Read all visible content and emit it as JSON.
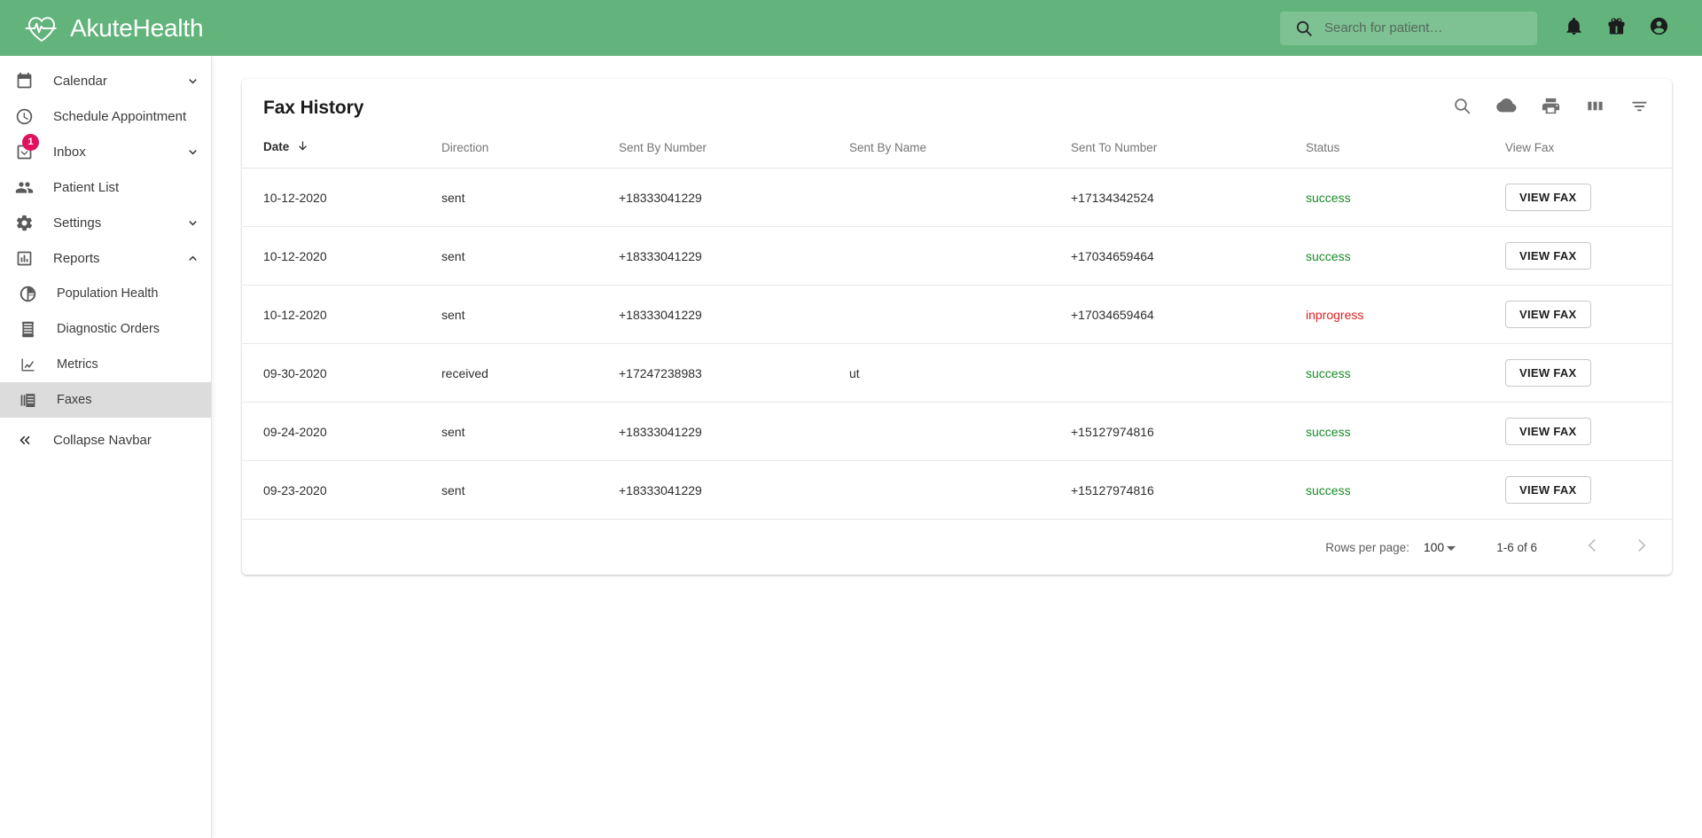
{
  "header": {
    "brand": "AkuteHealth",
    "brand_icon": "heartbeat-heart-icon",
    "search": {
      "placeholder": "Search for patient…",
      "value": "",
      "icon": "search-icon"
    },
    "actions": [
      {
        "name": "notifications-button",
        "icon": "bell-icon"
      },
      {
        "name": "rewards-button",
        "icon": "gift-icon"
      },
      {
        "name": "account-button",
        "icon": "account-circle-icon"
      }
    ],
    "background_color": "#62b47c"
  },
  "sidebar": {
    "items": [
      {
        "label": "Calendar",
        "icon": "calendar-icon",
        "chevron": "chevron-down",
        "expandable": true,
        "active": false,
        "sub": false
      },
      {
        "label": "Schedule Appointment",
        "icon": "clock-icon",
        "chevron": "",
        "expandable": false,
        "active": false,
        "sub": false
      },
      {
        "label": "Inbox",
        "icon": "inbox-icon",
        "chevron": "chevron-down",
        "expandable": true,
        "active": false,
        "sub": false,
        "badge": "1"
      },
      {
        "label": "Patient List",
        "icon": "people-icon",
        "chevron": "",
        "expandable": false,
        "active": false,
        "sub": false
      },
      {
        "label": "Settings",
        "icon": "gear-icon",
        "chevron": "chevron-down",
        "expandable": true,
        "active": false,
        "sub": false
      },
      {
        "label": "Reports",
        "icon": "bar-chart-icon",
        "chevron": "chevron-up",
        "expandable": true,
        "active": false,
        "sub": false
      },
      {
        "label": "Population Health",
        "icon": "pie-chart-icon",
        "chevron": "",
        "expandable": false,
        "active": false,
        "sub": true
      },
      {
        "label": "Diagnostic Orders",
        "icon": "receipt-icon",
        "chevron": "",
        "expandable": false,
        "active": false,
        "sub": true
      },
      {
        "label": "Metrics",
        "icon": "line-chart-icon",
        "chevron": "",
        "expandable": false,
        "active": false,
        "sub": true
      },
      {
        "label": "Faxes",
        "icon": "fax-document-icon",
        "chevron": "",
        "expandable": false,
        "active": true,
        "sub": true
      }
    ],
    "collapse": {
      "label": "Collapse Navbar",
      "icon": "chevron-double-left-icon"
    },
    "badge_color": "#e0115f",
    "active_color": "#dcdcdc"
  },
  "card": {
    "title": "Fax History",
    "toolbar": [
      {
        "name": "table-search-button",
        "icon": "search-icon"
      },
      {
        "name": "download-button",
        "icon": "cloud-download-icon"
      },
      {
        "name": "print-button",
        "icon": "print-icon"
      },
      {
        "name": "columns-button",
        "icon": "view-column-icon"
      },
      {
        "name": "filter-button",
        "icon": "filter-list-icon"
      }
    ],
    "table": {
      "columns": [
        {
          "label": "Date",
          "key": "date",
          "sorted": true,
          "sort_dir": "desc"
        },
        {
          "label": "Direction",
          "key": "dir",
          "sorted": false
        },
        {
          "label": "Sent By Number",
          "key": "sbn",
          "sorted": false
        },
        {
          "label": "Sent By Name",
          "key": "sbna",
          "sorted": false
        },
        {
          "label": "Sent To Number",
          "key": "stn",
          "sorted": false
        },
        {
          "label": "Status",
          "key": "status",
          "sorted": false
        },
        {
          "label": "View Fax",
          "key": "view",
          "sorted": false
        }
      ],
      "rows": [
        {
          "date": "10-12-2020",
          "dir": "sent",
          "sbn": "+18333041229",
          "sbna": "",
          "stn": "+17134342524",
          "status": "success",
          "status_kind": "success",
          "view": "VIEW FAX"
        },
        {
          "date": "10-12-2020",
          "dir": "sent",
          "sbn": "+18333041229",
          "sbna": "",
          "stn": "+17034659464",
          "status": "success",
          "status_kind": "success",
          "view": "VIEW FAX"
        },
        {
          "date": "10-12-2020",
          "dir": "sent",
          "sbn": "+18333041229",
          "sbna": "",
          "stn": "+17034659464",
          "status": "inprogress",
          "status_kind": "inprogress",
          "view": "VIEW FAX"
        },
        {
          "date": "09-30-2020",
          "dir": "received",
          "sbn": "+17247238983",
          "sbna": "ut",
          "stn": "",
          "status": "success",
          "status_kind": "success",
          "view": "VIEW FAX"
        },
        {
          "date": "09-24-2020",
          "dir": "sent",
          "sbn": "+18333041229",
          "sbna": "",
          "stn": "+15127974816",
          "status": "success",
          "status_kind": "success",
          "view": "VIEW FAX"
        },
        {
          "date": "09-23-2020",
          "dir": "sent",
          "sbn": "+18333041229",
          "sbna": "",
          "stn": "+15127974816",
          "status": "success",
          "status_kind": "success",
          "view": "VIEW FAX"
        }
      ],
      "status_colors": {
        "success": "#1a8b27",
        "inprogress": "#e02020"
      }
    },
    "pagination": {
      "rows_per_page_label": "Rows per page:",
      "rows_per_page_value": "100",
      "range": "1-6 of 6",
      "prev_icon": "chevron-left-icon",
      "next_icon": "chevron-right-icon"
    }
  }
}
